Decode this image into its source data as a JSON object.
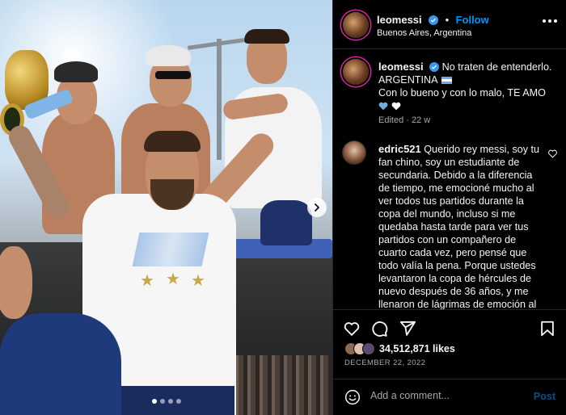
{
  "header": {
    "username": "leomessi",
    "follow_label": "Follow",
    "separator": "•",
    "location": "Buenos Aires, Argentina"
  },
  "caption": {
    "username": "leomessi",
    "line1": "No traten de entenderlo.",
    "line2": "ARGENTINA",
    "line3": "Con lo bueno y con lo malo, TE AMO",
    "edited": "Edited",
    "age": "22 w"
  },
  "comment": {
    "username": "edric521",
    "text": "Querido rey messi, soy tu fan chino, soy un estudiante de secundaria. Debido a la diferencia de tiempo, me emocioné mucho al ver todos tus partidos durante la copa del mundo, incluso si me quedaba hasta tarde para ver tus partidos con un compañero de cuarto cada vez, pero pensé que todo valía la pena. Porque ustedes levantaron la copa de hércules de nuevo después de 36 años, y me llenaron de lágrimas de emoción al ganar. Eres el ídolo que mi corazón"
  },
  "engagement": {
    "likes": "34,512,871 likes",
    "date": "DECEMBER 22, 2022"
  },
  "add_comment": {
    "placeholder": "Add a comment...",
    "post_label": "Post"
  },
  "carousel": {
    "count": 4,
    "active_index": 0
  },
  "icons": [
    "verified-badge-icon",
    "more-options-icon",
    "heart-icon",
    "comment-icon",
    "share-icon",
    "bookmark-icon",
    "emoji-icon",
    "next-arrow-icon"
  ],
  "colors": {
    "accent": "#0095f6",
    "verified": "#3897f0",
    "background": "#000000",
    "muted_text": "#a8a8a8"
  }
}
